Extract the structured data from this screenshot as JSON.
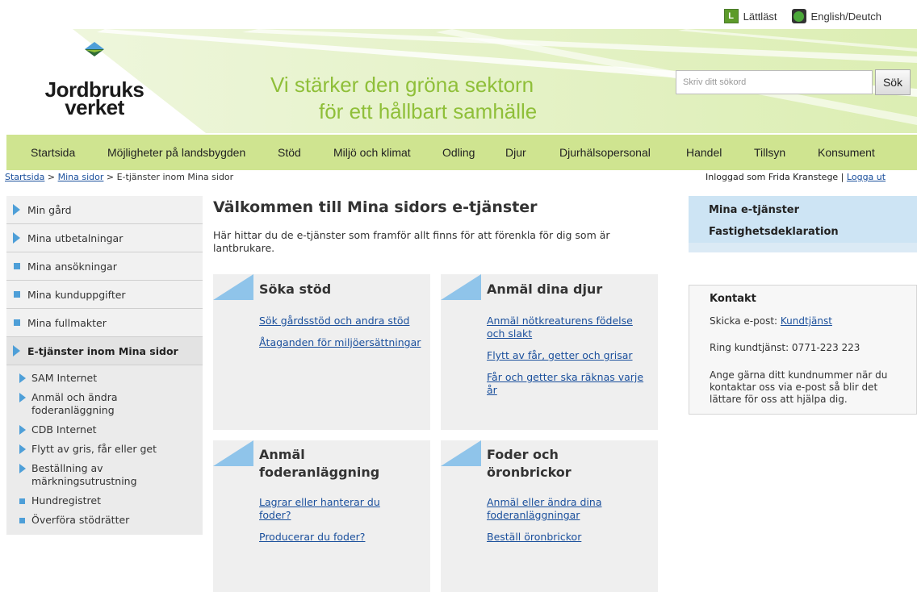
{
  "toplinks": {
    "easy_read": "Lättläst",
    "language": "English/Deutch"
  },
  "logo": {
    "line1": "Jordbruks",
    "line2": "verket"
  },
  "tagline": {
    "line1": "Vi stärker den gröna sektorn",
    "line2": "för ett hållbart samhälle"
  },
  "search": {
    "placeholder": "Skriv ditt sökord",
    "button": "Sök"
  },
  "nav": [
    "Startsida",
    "Möjligheter på landsbygden",
    "Stöd",
    "Miljö och klimat",
    "Odling",
    "Djur",
    "Djurhälsopersonal",
    "Handel",
    "Tillsyn",
    "Konsument"
  ],
  "breadcrumb": {
    "home": "Startsida",
    "sep": ">",
    "mina_sidor": "Mina sidor",
    "current": "E-tjänster inom Mina sidor"
  },
  "login": {
    "text": "Inloggad som Frida Kranstege",
    "divider": "|",
    "logout": "Logga ut"
  },
  "sidebar": {
    "items": [
      {
        "label": "Min gård",
        "marker": "triangle"
      },
      {
        "label": "Mina utbetalningar",
        "marker": "triangle"
      },
      {
        "label": "Mina ansökningar",
        "marker": "square"
      },
      {
        "label": "Mina kunduppgifter",
        "marker": "square"
      },
      {
        "label": "Mina fullmakter",
        "marker": "square"
      },
      {
        "label": "E-tjänster inom Mina sidor",
        "marker": "triangle",
        "active": true
      }
    ],
    "subitems": [
      {
        "label": "SAM Internet",
        "marker": "triangle"
      },
      {
        "label": "Anmäl och ändra foderanläggning",
        "marker": "triangle"
      },
      {
        "label": "CDB Internet",
        "marker": "triangle"
      },
      {
        "label": "Flytt av gris, får eller get",
        "marker": "triangle"
      },
      {
        "label": "Beställning av märkningsutrustning",
        "marker": "triangle"
      },
      {
        "label": "Hundregistret",
        "marker": "square"
      },
      {
        "label": "Överföra stödrätter",
        "marker": "square"
      }
    ]
  },
  "main": {
    "title": "Välkommen till Mina sidors e-tjänster",
    "intro": "Här hittar du de e-tjänster som framför allt finns för att förenkla för dig som är lantbrukare.",
    "cards": [
      {
        "title": "Söka stöd",
        "links": [
          "Sök gårdsstöd och andra stöd",
          "Åtaganden för miljöersättningar"
        ]
      },
      {
        "title": "Anmäl dina djur",
        "links": [
          "Anmäl nötkreaturens födelse och slakt",
          "Flytt av får, getter och grisar",
          "Får och getter ska räknas varje år"
        ]
      },
      {
        "title": "Anmäl foderanläggning",
        "links": [
          "Lagrar eller hanterar du foder?",
          "Producerar du foder?"
        ]
      },
      {
        "title": "Foder och öronbrickor",
        "links": [
          "Anmäl eller ändra dina foderanläggningar",
          "Beställ öronbrickor"
        ]
      }
    ]
  },
  "right": {
    "links": [
      "Mina e-tjänster",
      "Fastighetsdeklaration"
    ],
    "contact": {
      "title": "Kontakt",
      "email_prefix": "Skicka e-post:",
      "email_link": "Kundtjänst",
      "phone": "Ring kundtjänst: 0771-223 223",
      "note": "Ange gärna ditt kundnummer när du kontaktar oss via e-post så blir det lättare för oss att hjälpa dig."
    }
  },
  "colors": {
    "accent_green": "#8fbf39",
    "nav_green": "#cfe490",
    "accent_blue": "#4e9fd8",
    "link_blue": "#1a4f9c"
  }
}
